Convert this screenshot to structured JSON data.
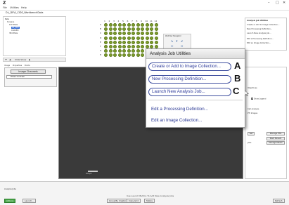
{
  "app": {
    "logo": "Z",
    "window_controls": [
      "–",
      "□",
      "✕"
    ]
  },
  "menu": [
    "File",
    "Utilities",
    "Help"
  ],
  "path": "D:\\_DEV\\_CIDS_WorkbenchData",
  "tree": {
    "items": [
      "Beta",
      "Screens",
      "12P Plate",
      "A1_003",
      "CLOSED",
      "384 Plate"
    ],
    "selected_index": 3
  },
  "plate": {
    "columns": [
      "1",
      "2",
      "3",
      "4",
      "5",
      "6",
      "7",
      "8",
      "9",
      "10",
      "11",
      "12"
    ],
    "rows": [
      "A",
      "B",
      "C",
      "D",
      "E",
      "F",
      "G",
      "H"
    ],
    "well_color": "#7d9c2c"
  },
  "well_navigator": {
    "title": "Well Nav Navigator"
  },
  "slide_controls": {
    "slide_show_label": "Slide Show"
  },
  "side_menu": {
    "title": "Analysis Job Utilities",
    "items": [
      "Create or Add to Image Collection...",
      "New Processing Definition...",
      "Launch New Analysis Job...",
      "Edit a Processing Definition...",
      "Edit an Image Collection..."
    ]
  },
  "left_panel": {
    "tabs": [
      "Image",
      "Properties",
      "Points"
    ],
    "channels_button": "Image Channels",
    "channel_row": "Phase Contrast"
  },
  "viewer": {
    "scale_label": "100 µm"
  },
  "right_lower": {
    "show_legend": "Show Legend",
    "manage_button": "Manage PTIs",
    "set_button": "Set",
    "start_button": "Start Stream",
    "manage_masks": "Manage Masks",
    "labels": [
      "Objectives",
      "Cell Analysis",
      "PTI Images",
      "Jobs"
    ]
  },
  "popup": {
    "title": "Analysis Job Utilities",
    "highlighted": [
      {
        "label": "Create or Add to Image Collection...",
        "letter": "A"
      },
      {
        "label": "New Processing Definition...",
        "letter": "B"
      },
      {
        "label": "Launch New Analysis Job...",
        "letter": "C"
      }
    ],
    "plain": [
      "Edit a Processing Definition...",
      "Edit an Image Collection..."
    ],
    "accent_color": "#2d3a9a"
  },
  "bottom": {
    "status_label": "Analysis Jobs",
    "hint": "Use Launch Button To Add New Analysis Jobs",
    "buttons": [
      "Actions",
      "Launch...",
      "Group By Creator",
      "Copy Grid",
      "Status"
    ],
    "right_button": "Refresh"
  }
}
